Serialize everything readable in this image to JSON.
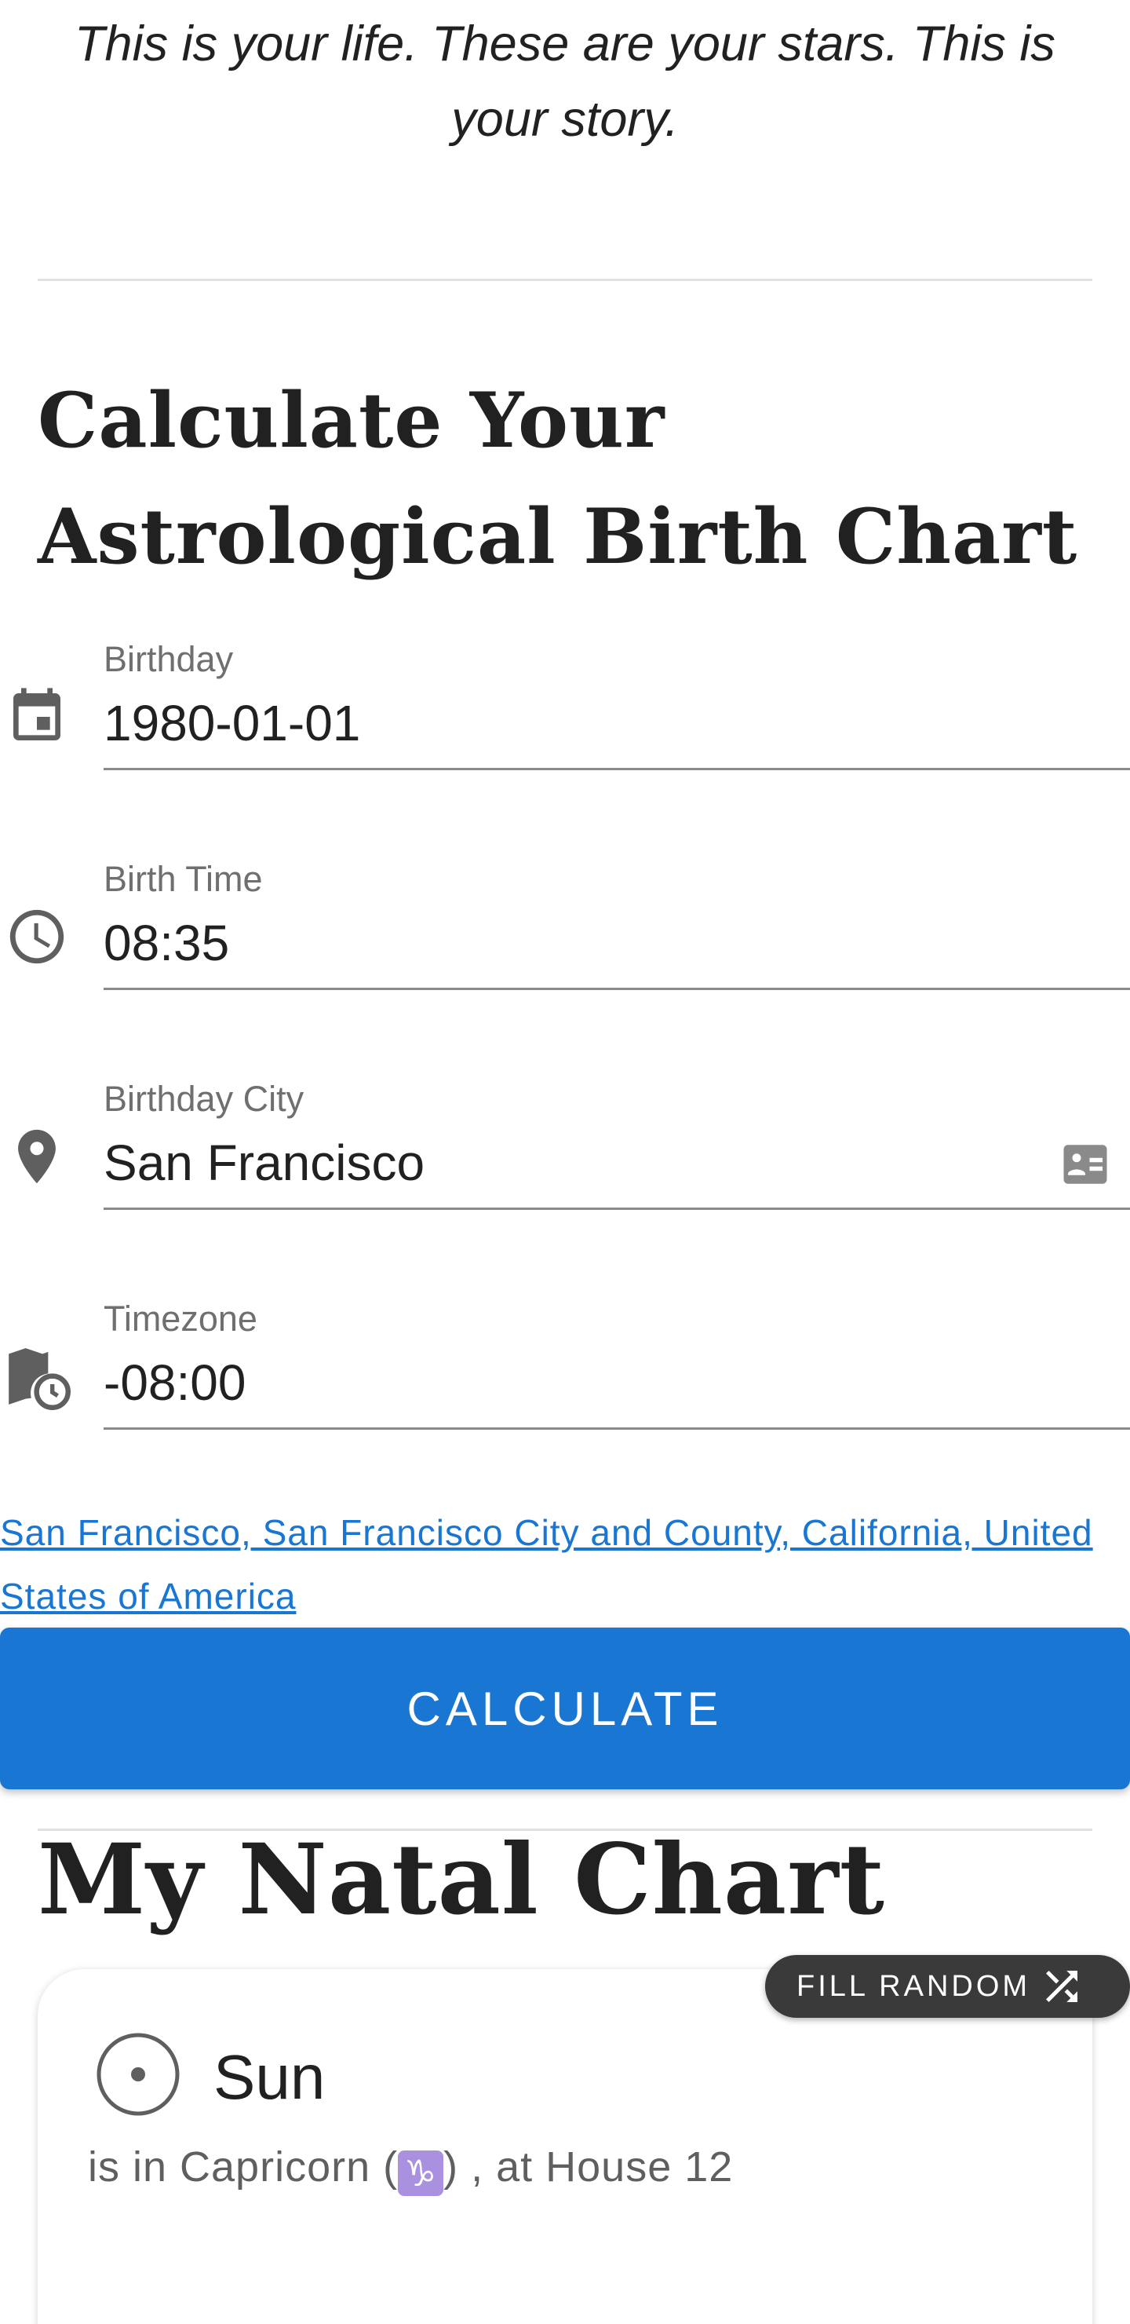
{
  "tagline": "This is your life. These are your stars. This is your story.",
  "form": {
    "heading": "Calculate Your Astrological Birth Chart",
    "birthday": {
      "label": "Birthday",
      "value": "1980-01-01",
      "icon": "calendar-icon"
    },
    "birth_time": {
      "label": "Birth Time",
      "value": "08:35",
      "icon": "clock-icon"
    },
    "birth_city": {
      "label": "Birthday City",
      "value": "San Francisco",
      "icon": "location-pin-icon",
      "trailing_icon": "contact-card-icon"
    },
    "timezone": {
      "label": "Timezone",
      "value": "-08:00",
      "icon": "map-clock-icon"
    },
    "location_link": "San Francisco, San Francisco City and County, California, United States of America",
    "calculate_label": "CALCULATE"
  },
  "natal": {
    "heading": "My Natal Chart",
    "fill_random_label": "FILL RANDOM",
    "planet": {
      "name": "Sun",
      "desc_prefix": "is in Capricorn (",
      "sign_glyph": "♑",
      "desc_suffix": ") , at House 12"
    }
  },
  "colors": {
    "primary": "#1976d2",
    "link": "#1976d2",
    "fill_random_bg": "#3a3a3a",
    "sign_glyph_bg": "#a991e0"
  }
}
